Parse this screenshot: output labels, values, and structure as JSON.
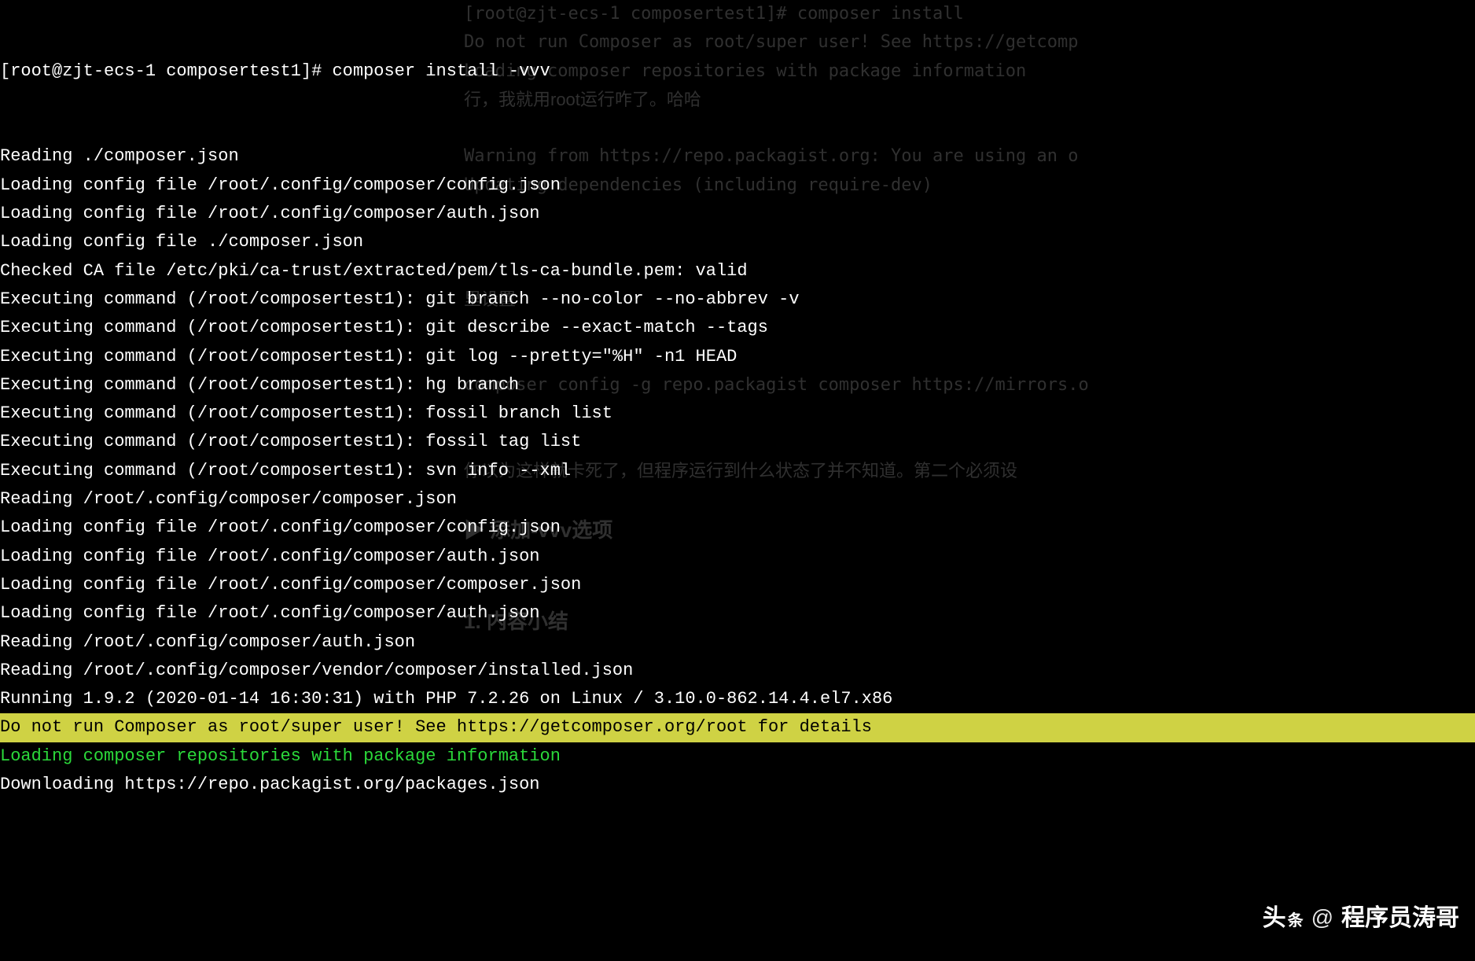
{
  "prompt_line": {
    "prompt": "[root@zjt-ecs-1 composertest1]# ",
    "command": "composer install -vvv"
  },
  "output_lines": [
    {
      "text": "Reading ./composer.json",
      "style": "normal"
    },
    {
      "text": "Loading config file /root/.config/composer/config.json",
      "style": "normal"
    },
    {
      "text": "Loading config file /root/.config/composer/auth.json",
      "style": "normal"
    },
    {
      "text": "Loading config file ./composer.json",
      "style": "normal"
    },
    {
      "text": "Checked CA file /etc/pki/ca-trust/extracted/pem/tls-ca-bundle.pem: valid",
      "style": "normal"
    },
    {
      "text": "Executing command (/root/composertest1): git branch --no-color --no-abbrev -v",
      "style": "normal"
    },
    {
      "text": "Executing command (/root/composertest1): git describe --exact-match --tags",
      "style": "normal"
    },
    {
      "text": "Executing command (/root/composertest1): git log --pretty=\"%H\" -n1 HEAD",
      "style": "normal"
    },
    {
      "text": "Executing command (/root/composertest1): hg branch",
      "style": "normal"
    },
    {
      "text": "Executing command (/root/composertest1): fossil branch list",
      "style": "normal"
    },
    {
      "text": "Executing command (/root/composertest1): fossil tag list",
      "style": "normal"
    },
    {
      "text": "Executing command (/root/composertest1): svn info --xml",
      "style": "normal"
    },
    {
      "text": "Reading /root/.config/composer/composer.json",
      "style": "normal"
    },
    {
      "text": "Loading config file /root/.config/composer/config.json",
      "style": "normal"
    },
    {
      "text": "Loading config file /root/.config/composer/auth.json",
      "style": "normal"
    },
    {
      "text": "Loading config file /root/.config/composer/composer.json",
      "style": "normal"
    },
    {
      "text": "Loading config file /root/.config/composer/auth.json",
      "style": "normal"
    },
    {
      "text": "Reading /root/.config/composer/auth.json",
      "style": "normal"
    },
    {
      "text": "Reading /root/.config/composer/vendor/composer/installed.json",
      "style": "normal"
    },
    {
      "text": "Running 1.9.2 (2020-01-14 16:30:31) with PHP 7.2.26 on Linux / 3.10.0-862.14.4.el7.x86",
      "style": "normal"
    },
    {
      "text": "Do not run Composer as root/super user! See https://getcomposer.org/root for details",
      "style": "hl-yellow-bg"
    },
    {
      "text": "Loading composer repositories with package information",
      "style": "green"
    },
    {
      "text": "Downloading https://repo.packagist.org/packages.json",
      "style": "normal"
    }
  ],
  "ghost_lines": [
    {
      "text": "[root@zjt-ecs-1 composertest1]# composer install",
      "cls": "ghost-mono"
    },
    {
      "text": "Do not run Composer as root/super user! See https://getcomp",
      "cls": "ghost-mono"
    },
    {
      "text": "Loading composer repositories with package information",
      "cls": "ghost-mono"
    },
    {
      "text": "行，我就用root运行咋了。哈哈",
      "cls": ""
    },
    {
      "text": "",
      "cls": ""
    },
    {
      "text": "Warning from https://repo.packagist.org: You are using an o",
      "cls": "ghost-mono"
    },
    {
      "text": "Updating dependencies (including require-dev)",
      "cls": "ghost-mono"
    },
    {
      "text": "",
      "cls": ""
    },
    {
      "text": "",
      "cls": ""
    },
    {
      "text": "",
      "cls": ""
    },
    {
      "text": "里设置",
      "cls": ""
    },
    {
      "text": "",
      "cls": ""
    },
    {
      "text": "",
      "cls": ""
    },
    {
      "text": "composer config -g repo.packagist composer https://mirrors.o",
      "cls": "ghost-mono"
    },
    {
      "text": "",
      "cls": ""
    },
    {
      "text": "",
      "cls": ""
    },
    {
      "text": "你以为这样就卡死了，但程序运行到什么状态了并不知道。第二个必须设",
      "cls": ""
    },
    {
      "text": "",
      "cls": ""
    },
    {
      "text": "▶ 添加-vvv选项",
      "cls": "ghost-heading"
    },
    {
      "text": "",
      "cls": ""
    },
    {
      "text": "",
      "cls": ""
    },
    {
      "text": "1. 内容小结",
      "cls": "ghost-heading"
    }
  ],
  "watermark": {
    "brand_big": "头",
    "brand_small": "条",
    "at": "@",
    "author": "程序员涛哥"
  }
}
